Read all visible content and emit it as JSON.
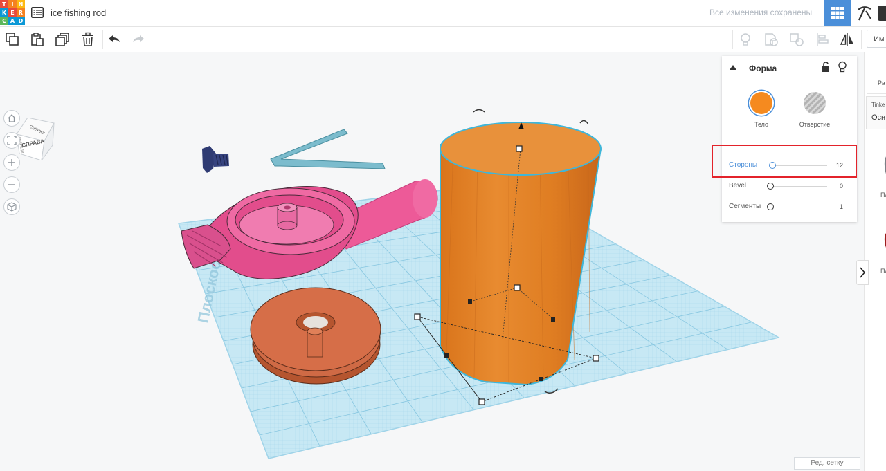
{
  "app": {
    "logo_letters": [
      "T",
      "I",
      "N",
      "K",
      "E",
      "R",
      "C",
      "A",
      "D"
    ],
    "logo_colors": [
      "#e84b3c",
      "#f58220",
      "#fdb913",
      "#0b98d6",
      "#e84b3c",
      "#f58220",
      "#5cb85c",
      "#0b98d6",
      "#0b98d6"
    ],
    "design_title": "ice fishing rod",
    "save_status": "Все изменения сохранены"
  },
  "toolbar": {
    "buttons": [
      "copy-icon",
      "paste-icon",
      "duplicate-icon",
      "trash-icon",
      "undo-icon",
      "redo-icon"
    ],
    "right_buttons": [
      "light-bulb-icon",
      "group-icon",
      "ungroup-icon",
      "align-icon",
      "mirror-icon"
    ],
    "import_label": "Им"
  },
  "viewcube": {
    "top_face": "СВЕРХУ",
    "front_face": "СПРАВА",
    "side_face": "СПЕРЕДИ"
  },
  "nav": [
    "home-icon",
    "fit-icon",
    "zoom-in-icon",
    "zoom-out-icon",
    "perspective-icon"
  ],
  "workplane_label": "Плоскость",
  "inspector": {
    "title": "Форма",
    "modes": [
      {
        "label": "Тело",
        "color": "#f58a1f"
      },
      {
        "label": "Отверстие",
        "color": "#b3b3b3"
      }
    ],
    "properties": [
      {
        "label": "Стороны",
        "value": "12",
        "fraction": 0.04
      },
      {
        "label": "Bevel",
        "value": "0",
        "fraction": 0
      },
      {
        "label": "Сегменты",
        "value": "1",
        "fraction": 0
      }
    ]
  },
  "right_panel": {
    "tab": "Ра",
    "dropdown_top": "Tinke",
    "dropdown_value": "Осн",
    "item1": "Па",
    "item2": "Па"
  },
  "grid_button": "Ред. сетку",
  "colors": {
    "accent": "#4b8fd9",
    "body_orange": "#f58a1f",
    "highlight": "#e3232b",
    "grid": "#bfe4f2",
    "pink": "#ed5a98"
  }
}
